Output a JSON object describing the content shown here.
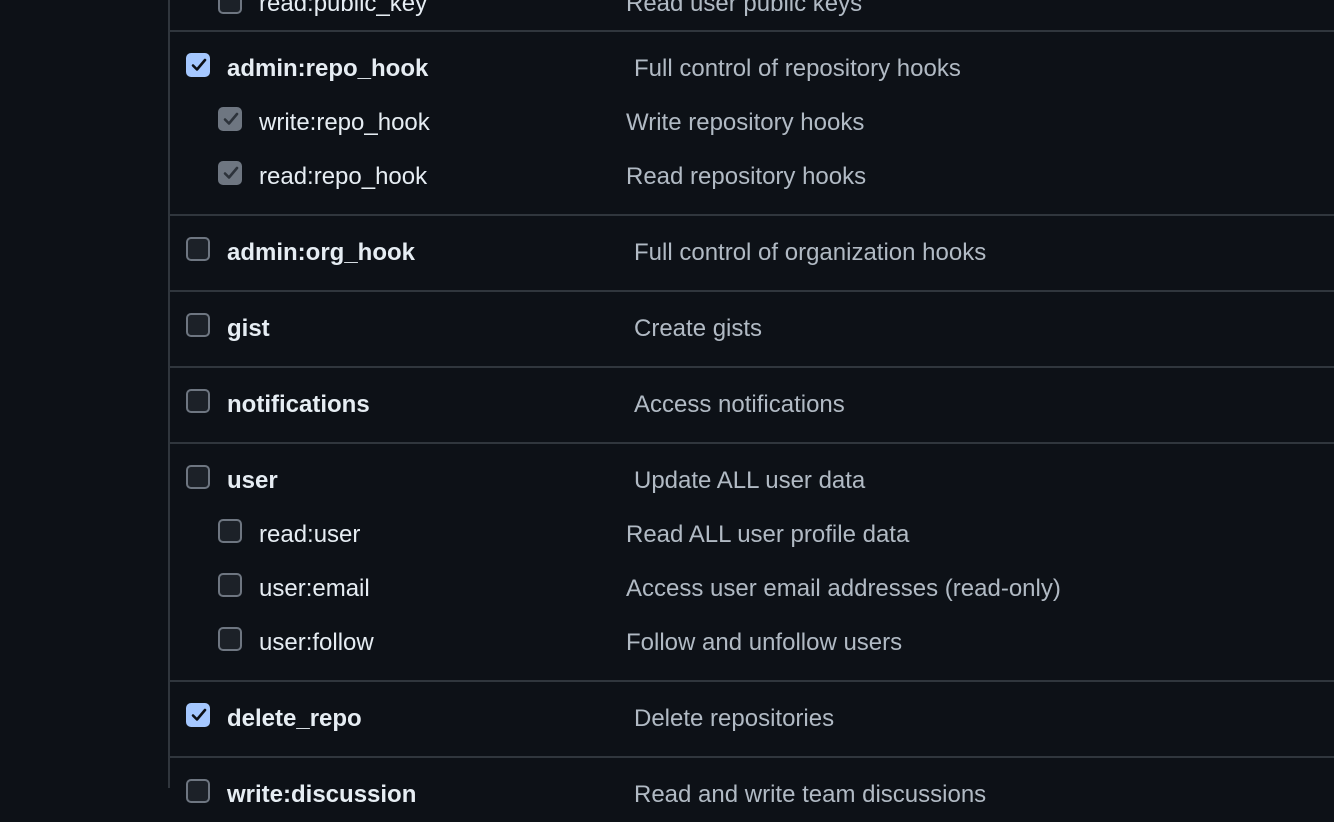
{
  "scopes": {
    "cut_top": {
      "name": "read:public_key",
      "desc": "Read user public keys"
    },
    "admin_repo_hook": {
      "name": "admin:repo_hook",
      "desc": "Full control of repository hooks",
      "checked": true,
      "children": [
        {
          "name": "write:repo_hook",
          "desc": "Write repository hooks",
          "state": "implied"
        },
        {
          "name": "read:repo_hook",
          "desc": "Read repository hooks",
          "state": "implied"
        }
      ]
    },
    "admin_org_hook": {
      "name": "admin:org_hook",
      "desc": "Full control of organization hooks",
      "checked": false
    },
    "gist": {
      "name": "gist",
      "desc": "Create gists",
      "checked": false
    },
    "notifications": {
      "name": "notifications",
      "desc": "Access notifications",
      "checked": false
    },
    "user": {
      "name": "user",
      "desc": "Update ALL user data",
      "checked": false,
      "children": [
        {
          "name": "read:user",
          "desc": "Read ALL user profile data",
          "state": "unchecked"
        },
        {
          "name": "user:email",
          "desc": "Access user email addresses (read-only)",
          "state": "unchecked"
        },
        {
          "name": "user:follow",
          "desc": "Follow and unfollow users",
          "state": "unchecked"
        }
      ]
    },
    "delete_repo": {
      "name": "delete_repo",
      "desc": "Delete repositories",
      "checked": true
    },
    "cut_bottom": {
      "name": "write:discussion",
      "desc": "Read and write team discussions"
    }
  },
  "icons": {
    "check": "checkmark-icon"
  },
  "colors": {
    "background": "#0d1117",
    "border": "#30363d",
    "checked": "#a5c8ff",
    "implied": "#6e7681"
  }
}
